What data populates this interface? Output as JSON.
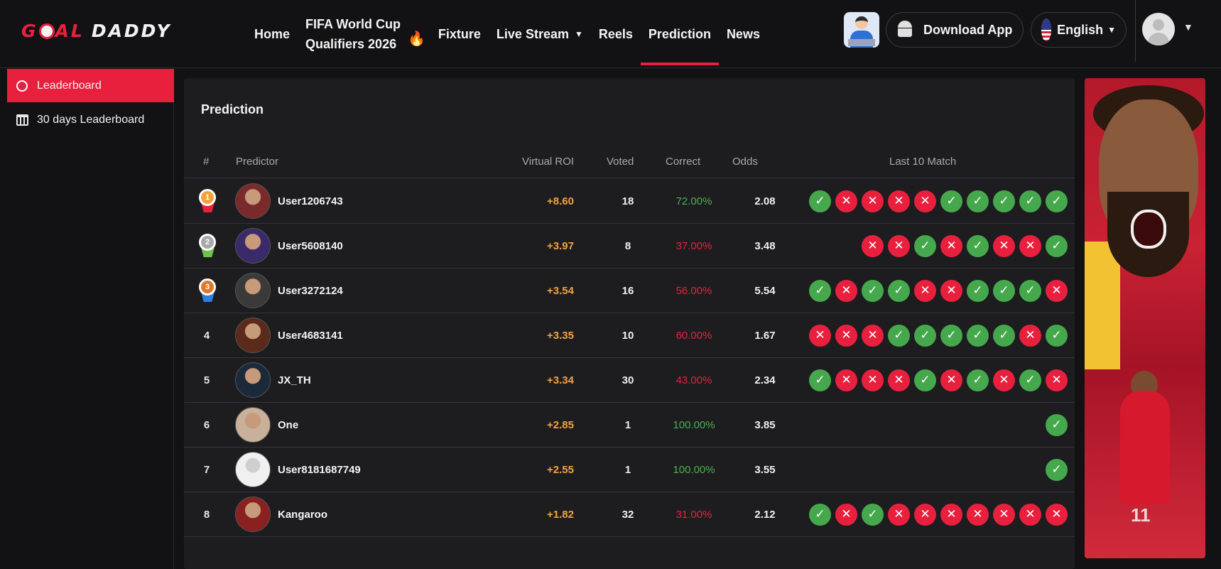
{
  "header": {
    "logo_left": "G",
    "logo_mid": "AL",
    "logo_right": "DADDY",
    "nav": {
      "home": "Home",
      "wc_line1": "FIFA World Cup",
      "wc_line2": "Qualifiers 2026",
      "fixture": "Fixture",
      "live_stream": "Live Stream",
      "reels": "Reels",
      "prediction": "Prediction",
      "news": "News"
    },
    "download_label": "Download App",
    "language_label": "English"
  },
  "sidebar": {
    "items": [
      {
        "label": "Leaderboard",
        "icon": "award-icon"
      },
      {
        "label": "30 days Leaderboard",
        "icon": "calendar-icon"
      }
    ]
  },
  "card": {
    "title": "Prediction",
    "headers": {
      "rank": "#",
      "predictor": "Predictor",
      "roi": "Virtual ROI",
      "voted": "Voted",
      "correct": "Correct",
      "odds": "Odds",
      "last10": "Last 10 Match"
    },
    "rows": [
      {
        "rank": "1",
        "name": "User1206743",
        "roi": "+8.60",
        "voted": "18",
        "correct": "72.00%",
        "correct_good": true,
        "odds": "2.08",
        "last": "WLLLLWWWWW"
      },
      {
        "rank": "2",
        "name": "User5608140",
        "roi": "+3.97",
        "voted": "8",
        "correct": "37.00%",
        "correct_good": false,
        "odds": "3.48",
        "last": "LLWLWLLW"
      },
      {
        "rank": "3",
        "name": "User3272124",
        "roi": "+3.54",
        "voted": "16",
        "correct": "56.00%",
        "correct_good": false,
        "odds": "5.54",
        "last": "WLWWLLWWWL"
      },
      {
        "rank": "4",
        "name": "User4683141",
        "roi": "+3.35",
        "voted": "10",
        "correct": "60.00%",
        "correct_good": false,
        "odds": "1.67",
        "last": "LLLWWWWWLW"
      },
      {
        "rank": "5",
        "name": "JX_TH",
        "roi": "+3.34",
        "voted": "30",
        "correct": "43.00%",
        "correct_good": false,
        "odds": "2.34",
        "last": "WLLLWLWLWL"
      },
      {
        "rank": "6",
        "name": "One",
        "roi": "+2.85",
        "voted": "1",
        "correct": "100.00%",
        "correct_good": true,
        "odds": "3.85",
        "last": "W"
      },
      {
        "rank": "7",
        "name": "User8181687749",
        "roi": "+2.55",
        "voted": "1",
        "correct": "100.00%",
        "correct_good": true,
        "odds": "3.55",
        "last": "W"
      },
      {
        "rank": "8",
        "name": "Kangaroo",
        "roi": "+1.82",
        "voted": "32",
        "correct": "31.00%",
        "correct_good": false,
        "odds": "2.12",
        "last": "WLWLLLLLLL"
      }
    ]
  },
  "colors": {
    "accent": "#e8203e",
    "win": "#46a84c",
    "loss": "#e8203e",
    "roi": "#f4a341"
  }
}
